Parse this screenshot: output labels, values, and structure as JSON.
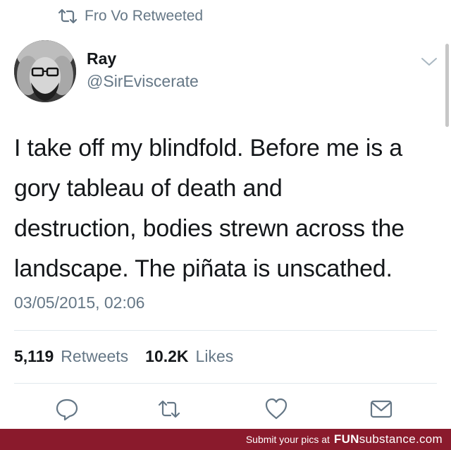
{
  "retweet": {
    "text": "Fro Vo Retweeted",
    "icon": "retweet-icon"
  },
  "author": {
    "name": "Ray",
    "handle": "@SirEviscerate"
  },
  "tweet": {
    "lines": [
      "I take off my blindfold. Before me is a",
      "gory tableau of death and",
      "destruction, bodies strewn across the",
      "landscape. The piñata is unscathed."
    ]
  },
  "timestamp": "03/05/2015, 02:06",
  "stats": {
    "retweets_count": "5,119",
    "retweets_label": "Retweets",
    "likes_count": "10.2K",
    "likes_label": "Likes"
  },
  "actions": [
    "reply-icon",
    "retweet-icon",
    "heart-icon",
    "message-icon"
  ],
  "footer": {
    "prefix": "Submit your pics at",
    "brand_bold": "FUN",
    "brand_rest": "substance",
    "brand_tld": ".com"
  },
  "colors": {
    "muted": "#657786",
    "text": "#14171a",
    "footer_bg": "#8a1a2c",
    "divider": "#e1e8ed"
  }
}
